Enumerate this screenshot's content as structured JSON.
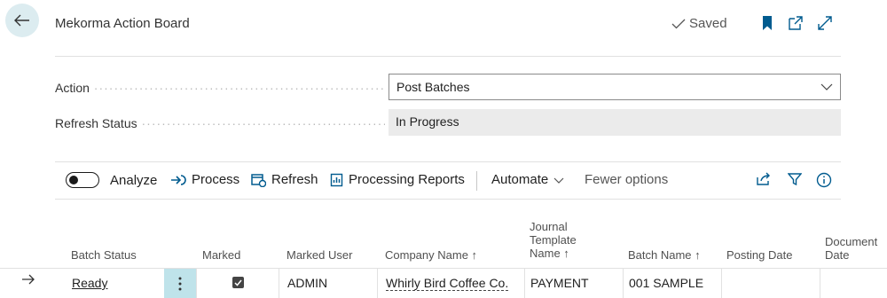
{
  "header": {
    "title": "Mekorma Action Board",
    "saved_label": "Saved"
  },
  "fields": {
    "action_label": "Action",
    "action_value": "Post Batches",
    "refresh_status_label": "Refresh Status",
    "refresh_status_value": "In Progress"
  },
  "actionbar": {
    "analyze": "Analyze",
    "process": "Process",
    "refresh": "Refresh",
    "processing_reports": "Processing Reports",
    "automate": "Automate",
    "fewer_options": "Fewer options"
  },
  "table": {
    "columns": {
      "batch_status": "Batch Status",
      "marked": "Marked",
      "marked_user": "Marked User",
      "company_name": "Company Name ↑",
      "journal_template_line1": "Journal",
      "journal_template_line2": "Template",
      "journal_template_line3": "Name ↑",
      "batch_name": "Batch Name ↑",
      "posting_date": "Posting Date",
      "document_date_line1": "Document",
      "document_date_line2": "Date"
    },
    "rows": [
      {
        "batch_status": "Ready",
        "marked": true,
        "marked_user": "ADMIN",
        "company_name": "Whirly Bird Coffee Co.",
        "journal_template": "PAYMENT",
        "batch_name": "001 SAMPLE",
        "posting_date": "",
        "document_date": ""
      }
    ]
  },
  "colors": {
    "accent": "#005b8f",
    "back_button_bg": "#dcecf0",
    "selected_cell_bg": "#bfe3ea",
    "readonly_bg": "#ebebeb"
  }
}
